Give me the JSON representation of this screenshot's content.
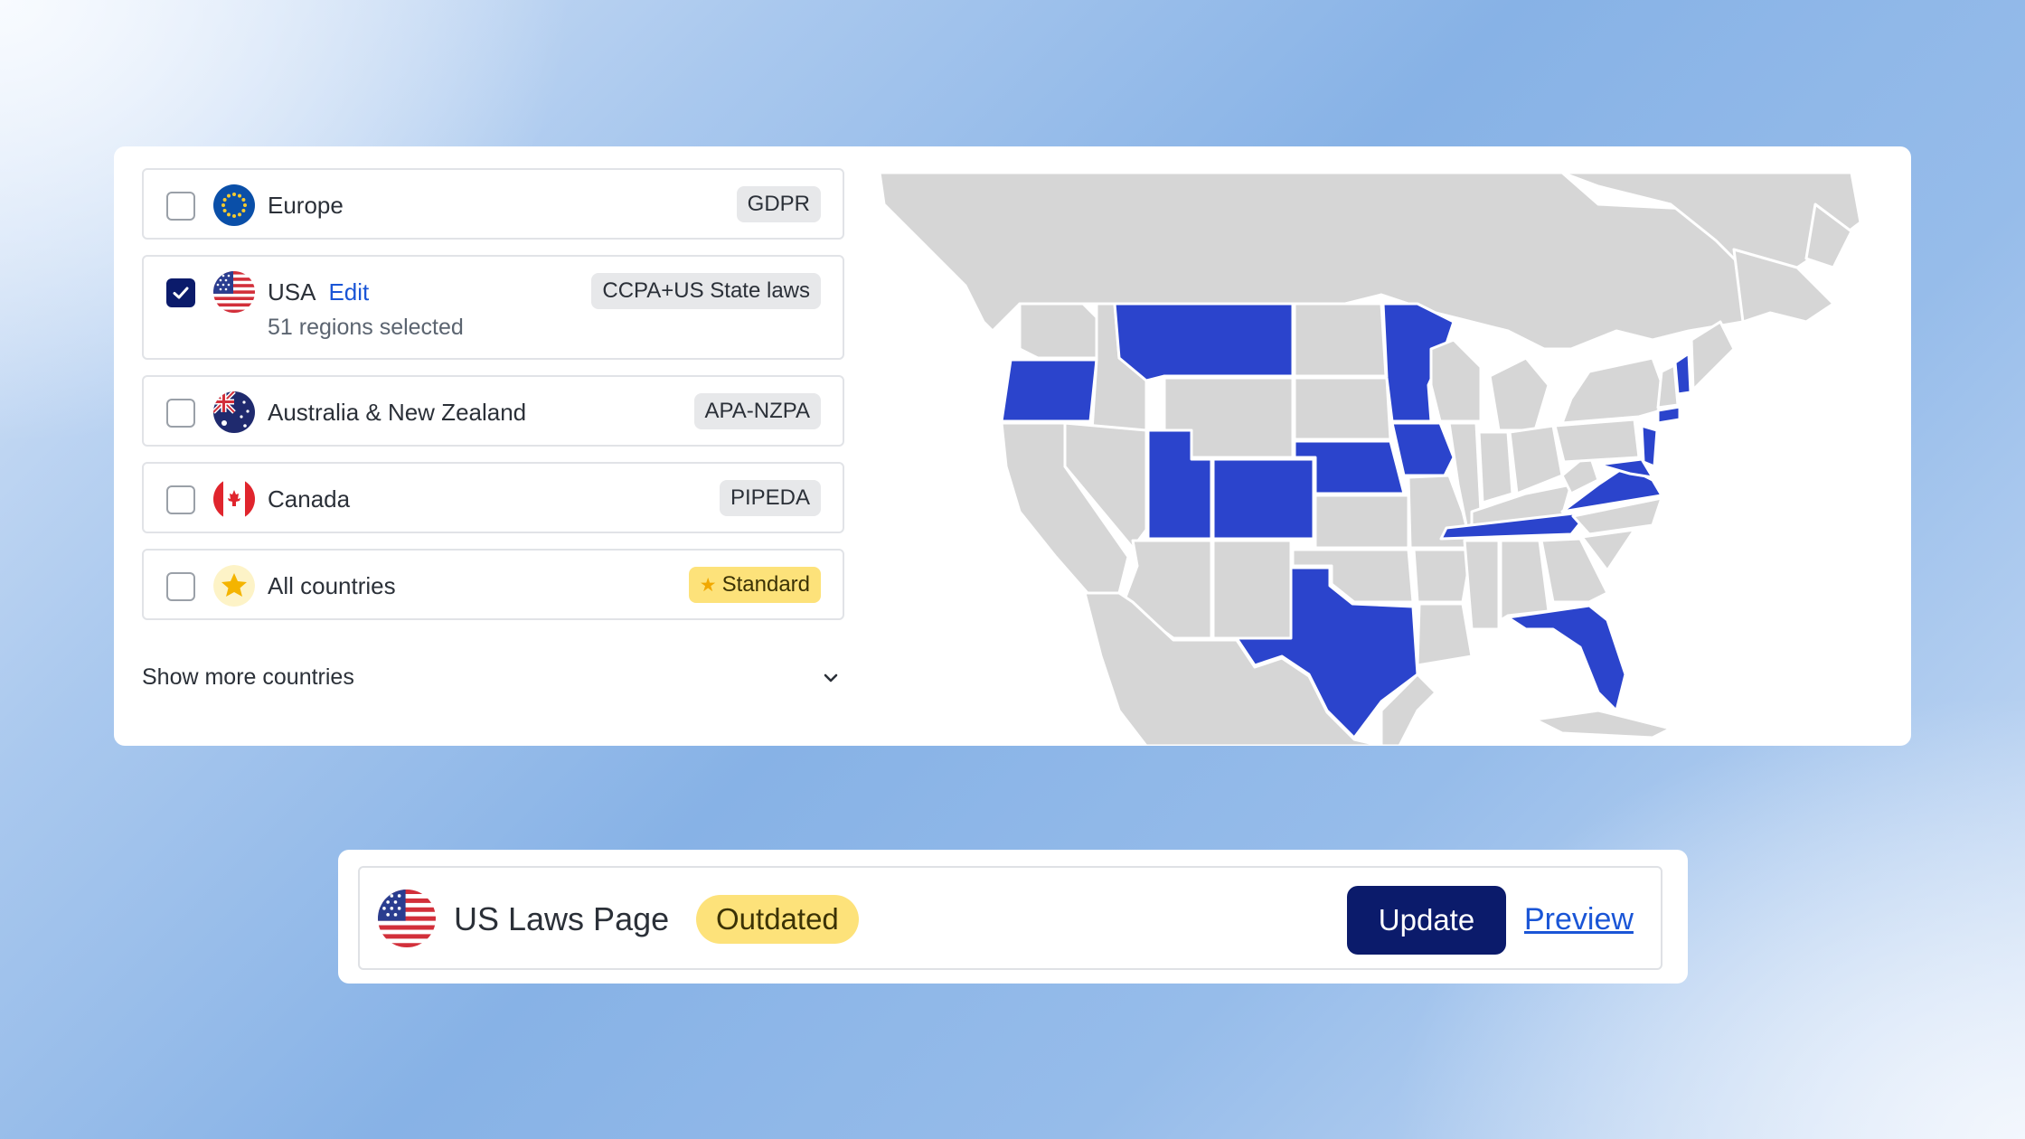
{
  "regions": [
    {
      "name": "Europe",
      "edit": "",
      "sub": "",
      "badge": "GDPR",
      "checked": false,
      "flag": "eu-flag-icon"
    },
    {
      "name": "USA",
      "edit": "Edit",
      "sub": "51 regions selected",
      "badge": "CCPA+US State laws",
      "checked": true,
      "flag": "us-flag-icon"
    },
    {
      "name": "Australia & New Zealand",
      "edit": "",
      "sub": "",
      "badge": "APA-NZPA",
      "checked": false,
      "flag": "australia-flag-icon"
    },
    {
      "name": "Canada",
      "edit": "",
      "sub": "",
      "badge": "PIPEDA",
      "checked": false,
      "flag": "canada-flag-icon"
    },
    {
      "name": "All countries",
      "edit": "",
      "sub": "",
      "badge": "Standard",
      "badge_icon": "star-icon",
      "checked": false,
      "flag": "star-icon"
    }
  ],
  "show_more_label": "Show more countries",
  "map": {
    "highlight_color": "#2b44cc",
    "base_color": "#d6d6d6",
    "highlighted_states": [
      "Oregon",
      "Montana",
      "Utah",
      "Colorado",
      "Nebraska",
      "Minnesota",
      "Iowa",
      "Texas",
      "Tennessee",
      "Virginia",
      "Florida",
      "Maryland",
      "Delaware",
      "New Jersey",
      "Connecticut",
      "New Hampshire"
    ]
  },
  "bottom": {
    "title": "US Laws Page",
    "status": "Outdated",
    "update_label": "Update",
    "preview_label": "Preview"
  },
  "colors": {
    "accent_dark": "#0b1b6b",
    "link": "#1a55d6",
    "badge_gold": "#fde27a"
  }
}
